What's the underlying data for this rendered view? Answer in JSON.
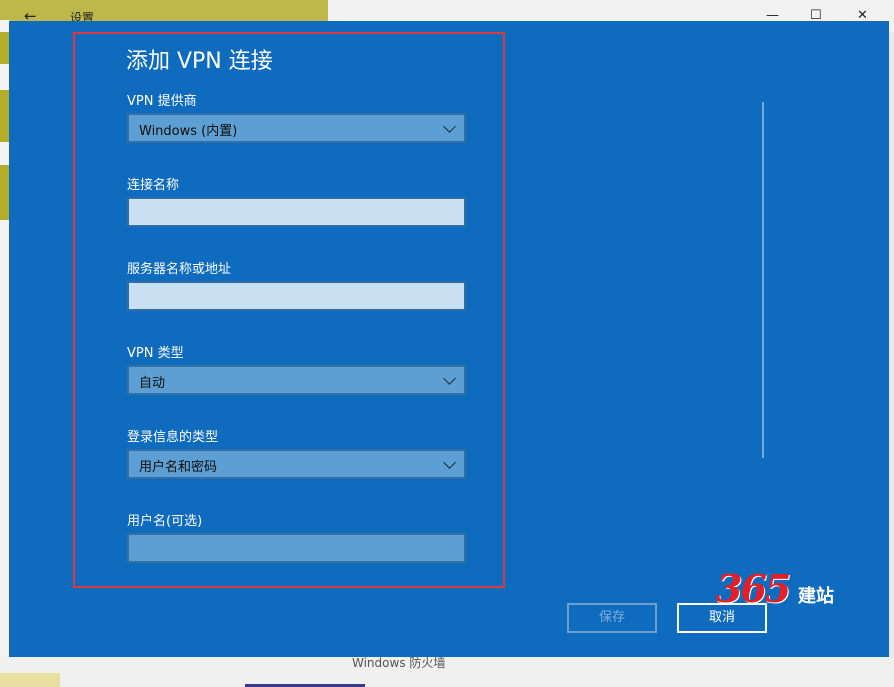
{
  "window": {
    "title": "设置",
    "back_glyph": "←",
    "minimize_glyph": "—",
    "maximize_glyph": "☐",
    "close_glyph": "✕"
  },
  "dialog": {
    "title": "添加 VPN 连接",
    "fields": {
      "provider": {
        "label": "VPN 提供商",
        "value": "Windows (内置)"
      },
      "connection_name": {
        "label": "连接名称",
        "value": ""
      },
      "server": {
        "label": "服务器名称或地址",
        "value": ""
      },
      "vpn_type": {
        "label": "VPN 类型",
        "value": "自动"
      },
      "signin_type": {
        "label": "登录信息的类型",
        "value": "用户名和密码"
      },
      "username": {
        "label": "用户名(可选)",
        "value": ""
      }
    },
    "buttons": {
      "save": "保存",
      "cancel": "取消"
    }
  },
  "background": {
    "bottom_text": "Windows 防火墙"
  },
  "watermark": {
    "number": "365",
    "text": "建站"
  },
  "colors": {
    "dialog_bg": "#0f6bbd",
    "highlight_frame": "#e0363e",
    "select_bg": "#5d9fd3",
    "input_bg": "#c9e0f0"
  }
}
